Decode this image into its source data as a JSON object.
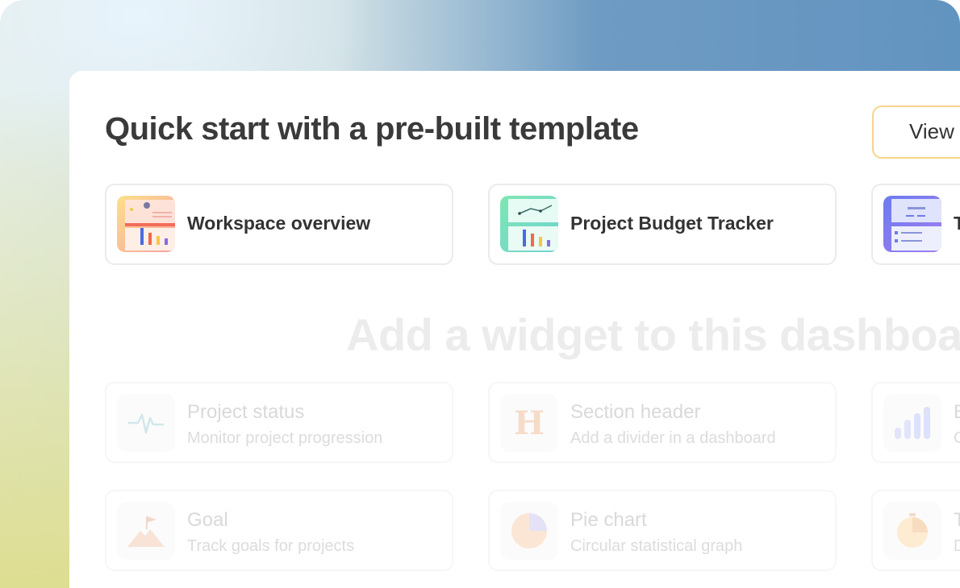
{
  "header": {
    "title": "Quick start with a pre-built template",
    "view_button": "View"
  },
  "templates": [
    {
      "label": "Workspace overview",
      "icon": "workspace-overview-thumbnail"
    },
    {
      "label": "Project Budget Tracker",
      "icon": "budget-tracker-thumbnail"
    },
    {
      "label": "T",
      "icon": "team-thumbnail"
    }
  ],
  "widgets_section": {
    "title": "Add a widget to this dashboard"
  },
  "widgets": [
    {
      "title": "Project status",
      "description": "Monitor project progression",
      "icon": "pulse-icon"
    },
    {
      "title": "Section header",
      "description": "Add a divider in a dashboard",
      "icon": "section-header-icon"
    },
    {
      "title": "B",
      "description": "C",
      "icon": "bar-chart-icon"
    },
    {
      "title": "Goal",
      "description": "Track goals for projects",
      "icon": "mountain-flag-icon"
    },
    {
      "title": "Pie chart",
      "description": "Circular statistical graph",
      "icon": "pie-chart-icon"
    },
    {
      "title": "T",
      "description": "D",
      "icon": "timer-icon"
    }
  ],
  "colors": {
    "view_button_border": "#f6d48a",
    "title_text": "#3a3a3a",
    "faded_text": "#d9d9d9"
  }
}
